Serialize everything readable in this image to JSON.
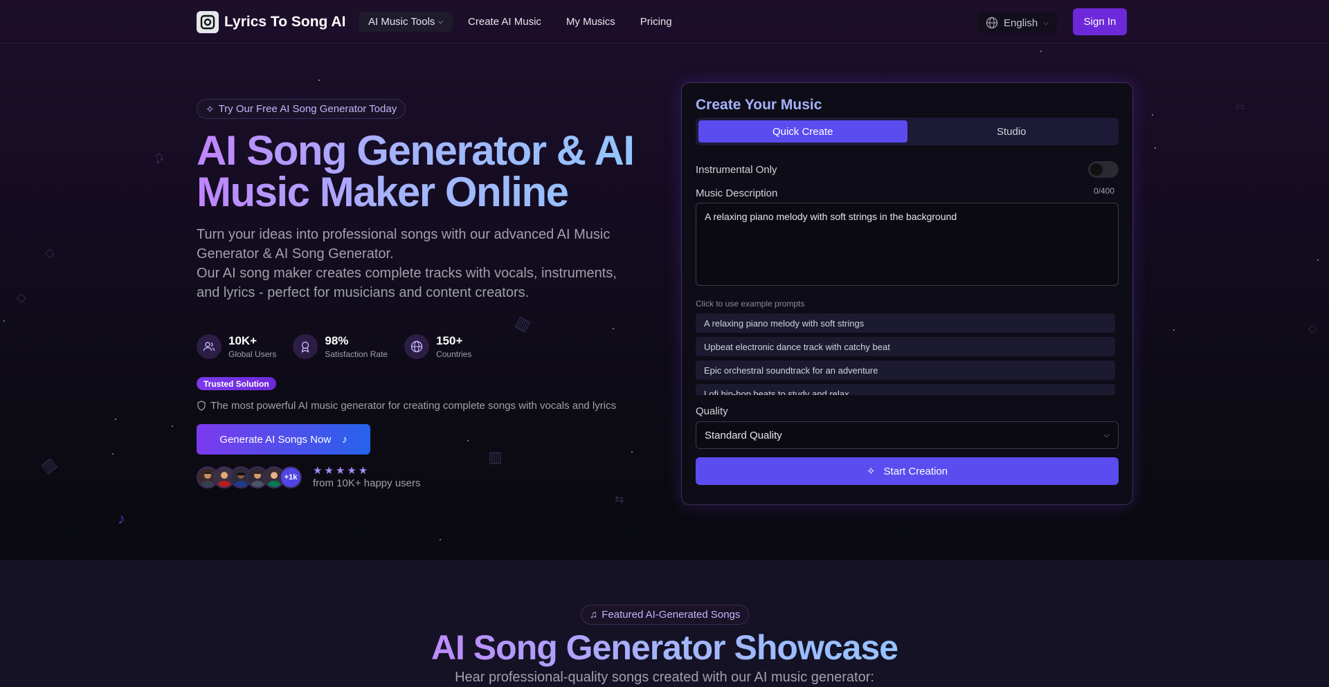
{
  "nav": {
    "brand": "Lyrics To Song AI",
    "links": [
      "AI Music Tools",
      "Create AI Music",
      "My Musics",
      "Pricing"
    ],
    "language": "English",
    "sign_in": "Sign In"
  },
  "hero": {
    "badge": "Try Our Free AI Song Generator Today",
    "title": "AI Song Generator & AI Music Maker Online",
    "desc_1": "Turn your ideas into professional songs with our advanced AI Music Generator & AI Song Generator.",
    "desc_2": "Our AI song maker creates complete tracks with vocals, instruments, and lyrics - perfect for musicians and content creators.",
    "stats": [
      {
        "value": "10K+",
        "label": "Global Users"
      },
      {
        "value": "98%",
        "label": "Satisfaction Rate"
      },
      {
        "value": "150+",
        "label": "Countries"
      }
    ],
    "trusted": "Trusted Solution",
    "powerful": "The most powerful AI music generator for creating complete songs with vocals and lyrics",
    "cta": "Generate AI Songs Now",
    "avatars_more": "+1k",
    "stars": "★★★★★",
    "happy_users": "from 10K+ happy users"
  },
  "panel": {
    "title": "Create Your Music",
    "tabs": [
      "Quick Create",
      "Studio"
    ],
    "instrumental_label": "Instrumental Only",
    "description_label": "Music Description",
    "counter": "0/400",
    "description_value": "A relaxing piano melody with soft strings in the background",
    "examples_label": "Click to use example prompts",
    "examples": [
      "A relaxing piano melody with soft strings",
      "Upbeat electronic dance track with catchy beat",
      "Epic orchestral soundtrack for an adventure",
      "Lofi hip-hop beats to study and relax"
    ],
    "quality_label": "Quality",
    "quality_value": "Standard Quality",
    "start": "Start Creation"
  },
  "showcase": {
    "badge": "Featured AI-Generated Songs",
    "title": "AI Song Generator Showcase",
    "subtitle": "Hear professional-quality songs created with our AI music generator:"
  },
  "colors": {
    "accent": "#6d28d9",
    "panel_button": "#5b4cf0",
    "title_gradient_start": "#c084fc",
    "title_gradient_end": "#93c5fd"
  }
}
